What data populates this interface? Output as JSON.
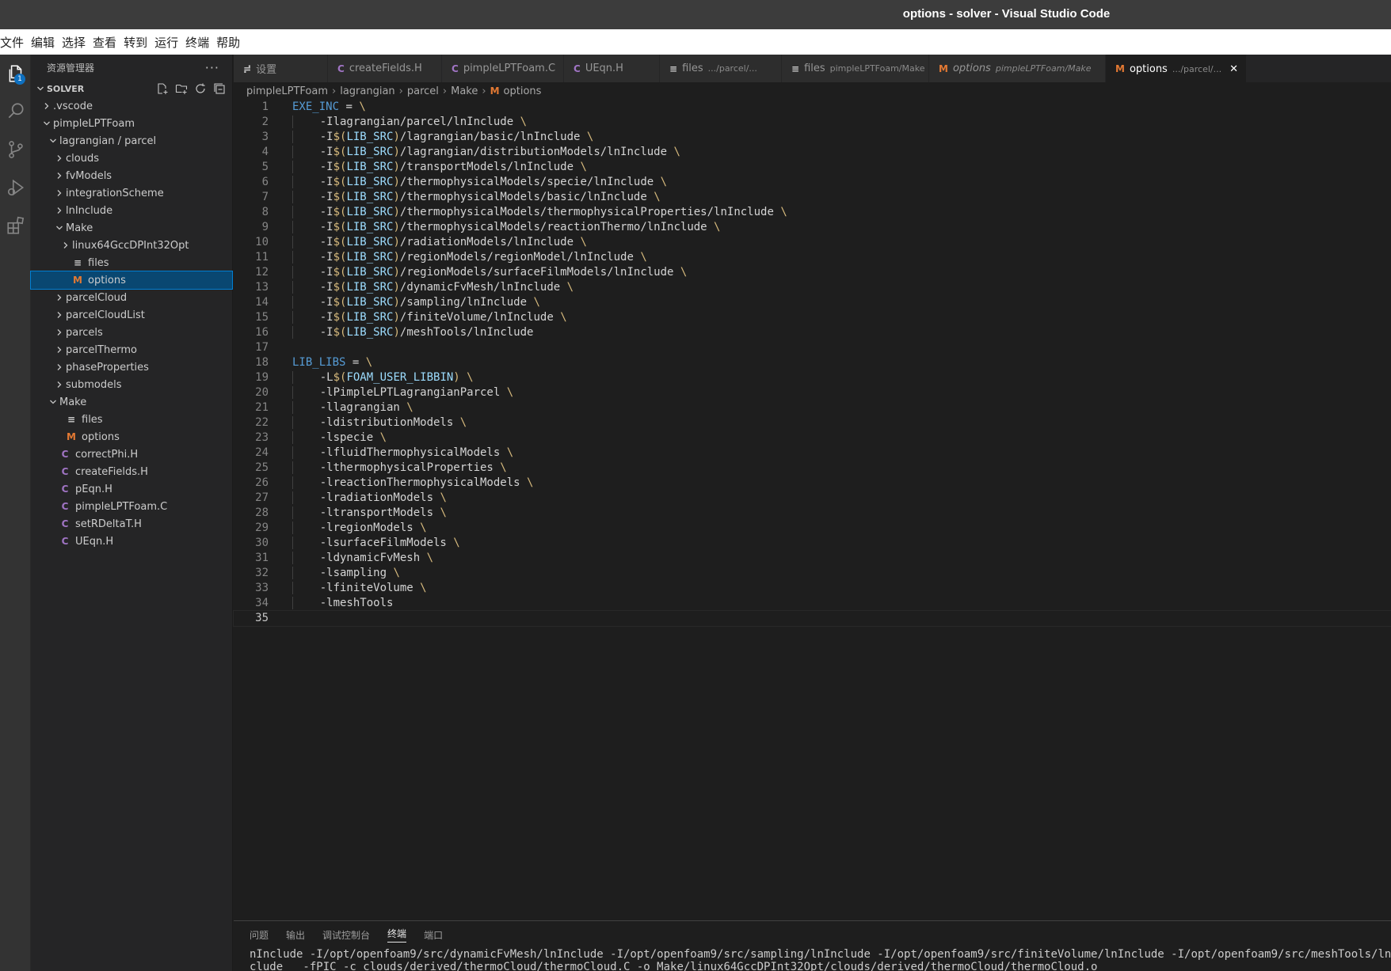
{
  "window": {
    "title": "options - solver - Visual Studio Code"
  },
  "menu": [
    "文件",
    "编辑",
    "选择",
    "查看",
    "转到",
    "运行",
    "终端",
    "帮助"
  ],
  "activity": {
    "explorer_badge": "1"
  },
  "sidebar": {
    "title": "资源管理器",
    "more": "···",
    "folder": "SOLVER",
    "tree": [
      {
        "label": ".vscode",
        "depth": 1,
        "kind": "folder",
        "open": false
      },
      {
        "label": "pimpleLPTFoam",
        "depth": 1,
        "kind": "folder",
        "open": true
      },
      {
        "label": "lagrangian / parcel",
        "depth": 2,
        "kind": "folder",
        "open": true
      },
      {
        "label": "clouds",
        "depth": 3,
        "kind": "folder",
        "open": false
      },
      {
        "label": "fvModels",
        "depth": 3,
        "kind": "folder",
        "open": false
      },
      {
        "label": "integrationScheme",
        "depth": 3,
        "kind": "folder",
        "open": false
      },
      {
        "label": "lnInclude",
        "depth": 3,
        "kind": "folder",
        "open": false
      },
      {
        "label": "Make",
        "depth": 3,
        "kind": "folder",
        "open": true
      },
      {
        "label": "linux64GccDPInt32Opt",
        "depth": 4,
        "kind": "folder",
        "open": false
      },
      {
        "label": "files",
        "depth": 4,
        "kind": "lines"
      },
      {
        "label": "options",
        "depth": 4,
        "kind": "m",
        "selected": true
      },
      {
        "label": "parcelCloud",
        "depth": 3,
        "kind": "folder",
        "open": false
      },
      {
        "label": "parcelCloudList",
        "depth": 3,
        "kind": "folder",
        "open": false
      },
      {
        "label": "parcels",
        "depth": 3,
        "kind": "folder",
        "open": false
      },
      {
        "label": "parcelThermo",
        "depth": 3,
        "kind": "folder",
        "open": false
      },
      {
        "label": "phaseProperties",
        "depth": 3,
        "kind": "folder",
        "open": false
      },
      {
        "label": "submodels",
        "depth": 3,
        "kind": "folder",
        "open": false
      },
      {
        "label": "Make",
        "depth": 2,
        "kind": "folder",
        "open": true
      },
      {
        "label": "files",
        "depth": 3,
        "kind": "lines"
      },
      {
        "label": "options",
        "depth": 3,
        "kind": "m"
      },
      {
        "label": "correctPhi.H",
        "depth": 2,
        "kind": "c"
      },
      {
        "label": "createFields.H",
        "depth": 2,
        "kind": "c"
      },
      {
        "label": "pEqn.H",
        "depth": 2,
        "kind": "c"
      },
      {
        "label": "pimpleLPTFoam.C",
        "depth": 2,
        "kind": "c"
      },
      {
        "label": "setRDeltaT.H",
        "depth": 2,
        "kind": "c"
      },
      {
        "label": "UEqn.H",
        "depth": 2,
        "kind": "c"
      }
    ]
  },
  "tabs": [
    {
      "icon": "≓",
      "label": "设置",
      "desc": ""
    },
    {
      "icon": "C",
      "label": "createFields.H",
      "desc": ""
    },
    {
      "icon": "C",
      "label": "pimpleLPTFoam.C",
      "desc": ""
    },
    {
      "icon": "C",
      "label": "UEqn.H",
      "desc": ""
    },
    {
      "icon": "≡",
      "label": "files",
      "desc": ".../parcel/..."
    },
    {
      "icon": "≡",
      "label": "files",
      "desc": "pimpleLPTFoam/Make",
      "dirty": true
    },
    {
      "icon": "M",
      "label": "options",
      "desc": "pimpleLPTFoam/Make",
      "italic": true
    },
    {
      "icon": "M",
      "label": "options",
      "desc": ".../parcel/...",
      "active": true
    }
  ],
  "breadcrumb": [
    "pimpleLPTFoam",
    "lagrangian",
    "parcel",
    "Make",
    "options"
  ],
  "code": [
    "EXE_INC = \\",
    "    -Ilagrangian/parcel/lnInclude \\",
    "    -I$(LIB_SRC)/lagrangian/basic/lnInclude \\",
    "    -I$(LIB_SRC)/lagrangian/distributionModels/lnInclude \\",
    "    -I$(LIB_SRC)/transportModels/lnInclude \\",
    "    -I$(LIB_SRC)/thermophysicalModels/specie/lnInclude \\",
    "    -I$(LIB_SRC)/thermophysicalModels/basic/lnInclude \\",
    "    -I$(LIB_SRC)/thermophysicalModels/thermophysicalProperties/lnInclude \\",
    "    -I$(LIB_SRC)/thermophysicalModels/reactionThermo/lnInclude \\",
    "    -I$(LIB_SRC)/radiationModels/lnInclude \\",
    "    -I$(LIB_SRC)/regionModels/regionModel/lnInclude \\",
    "    -I$(LIB_SRC)/regionModels/surfaceFilmModels/lnInclude \\",
    "    -I$(LIB_SRC)/dynamicFvMesh/lnInclude \\",
    "    -I$(LIB_SRC)/sampling/lnInclude \\",
    "    -I$(LIB_SRC)/finiteVolume/lnInclude \\",
    "    -I$(LIB_SRC)/meshTools/lnInclude",
    "",
    "LIB_LIBS = \\",
    "    -L$(FOAM_USER_LIBBIN) \\",
    "    -lPimpleLPTLagrangianParcel \\",
    "    -llagrangian \\",
    "    -ldistributionModels \\",
    "    -lspecie \\",
    "    -lfluidThermophysicalModels \\",
    "    -lthermophysicalProperties \\",
    "    -lreactionThermophysicalModels \\",
    "    -lradiationModels \\",
    "    -ltransportModels \\",
    "    -lregionModels \\",
    "    -lsurfaceFilmModels \\",
    "    -ldynamicFvMesh \\",
    "    -lsampling \\",
    "    -lfiniteVolume \\",
    "    -lmeshTools",
    ""
  ],
  "panel": {
    "tabs": [
      "问题",
      "输出",
      "调试控制台",
      "终端",
      "端口"
    ],
    "active": "终端",
    "terminal": [
      "nInclude -I/opt/openfoam9/src/dynamicFvMesh/lnInclude -I/opt/openfoam9/src/sampling/lnInclude -I/opt/openfoam9/src/finiteVolume/lnInclude -I/opt/openfoam9/src/meshTools/lnInclude -",
      "clude   -fPIC -c clouds/derived/thermoCloud/thermoCloud.C -o Make/linux64GccDPInt32Opt/clouds/derived/thermoCloud/thermoCloud.o"
    ]
  },
  "colors": {
    "accent": "#007fd4",
    "selection": "#094771",
    "keyword": "#569cd6",
    "backslash": "#d7ba7d",
    "variable": "#9cdcfe"
  }
}
